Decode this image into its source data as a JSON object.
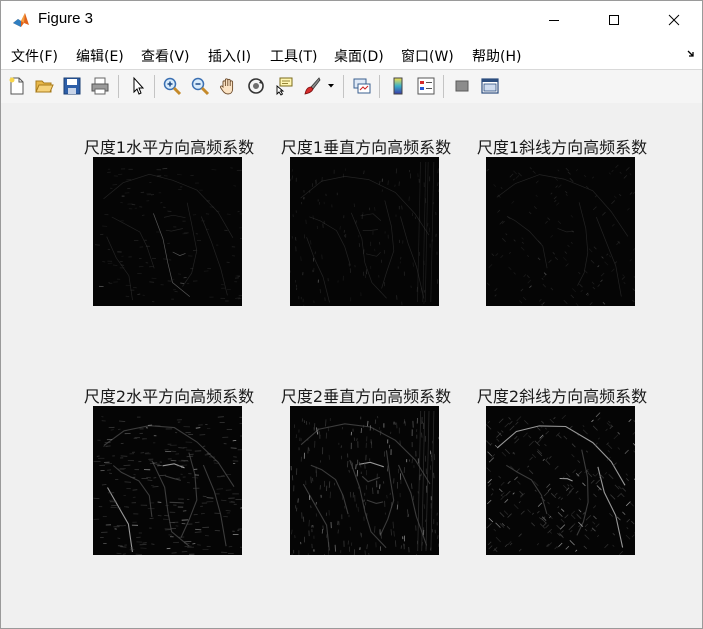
{
  "window": {
    "title": "Figure 3"
  },
  "menu": {
    "items": [
      {
        "label": "文件(F)",
        "name": "menu-file"
      },
      {
        "label": "编辑(E)",
        "name": "menu-edit"
      },
      {
        "label": "查看(V)",
        "name": "menu-view"
      },
      {
        "label": "插入(I)",
        "name": "menu-insert"
      },
      {
        "label": "工具(T)",
        "name": "menu-tools"
      },
      {
        "label": "桌面(D)",
        "name": "menu-desktop"
      },
      {
        "label": "窗口(W)",
        "name": "menu-window"
      },
      {
        "label": "帮助(H)",
        "name": "menu-help"
      }
    ]
  },
  "toolbar": {
    "icons": [
      "new-figure-icon",
      "open-file-icon",
      "save-icon",
      "print-icon",
      "edit-plot-arrow-icon",
      "zoom-in-icon",
      "zoom-out-icon",
      "pan-hand-icon",
      "rotate-3d-icon",
      "data-cursor-icon",
      "brush-icon",
      "link-plot-icon",
      "colorbar-icon",
      "legend-icon",
      "hide-plot-tools-icon",
      "show-plot-tools-icon"
    ]
  },
  "subplots": [
    {
      "title": "尺度1水平方向高频系数",
      "level": 1,
      "direction": "horizontal"
    },
    {
      "title": "尺度1垂直方向高频系数",
      "level": 1,
      "direction": "vertical"
    },
    {
      "title": "尺度1斜线方向高频系数",
      "level": 1,
      "direction": "diagonal"
    },
    {
      "title": "尺度2水平方向高频系数",
      "level": 2,
      "direction": "horizontal"
    },
    {
      "title": "尺度2垂直方向高频系数",
      "level": 2,
      "direction": "vertical"
    },
    {
      "title": "尺度2斜线方向高频系数",
      "level": 2,
      "direction": "diagonal"
    }
  ],
  "colors": {
    "image_background": "#050505",
    "edge_faint": "#4a4a4a",
    "edge_bright": "#bdbdbd",
    "figure_background": "#f0f0f0"
  }
}
